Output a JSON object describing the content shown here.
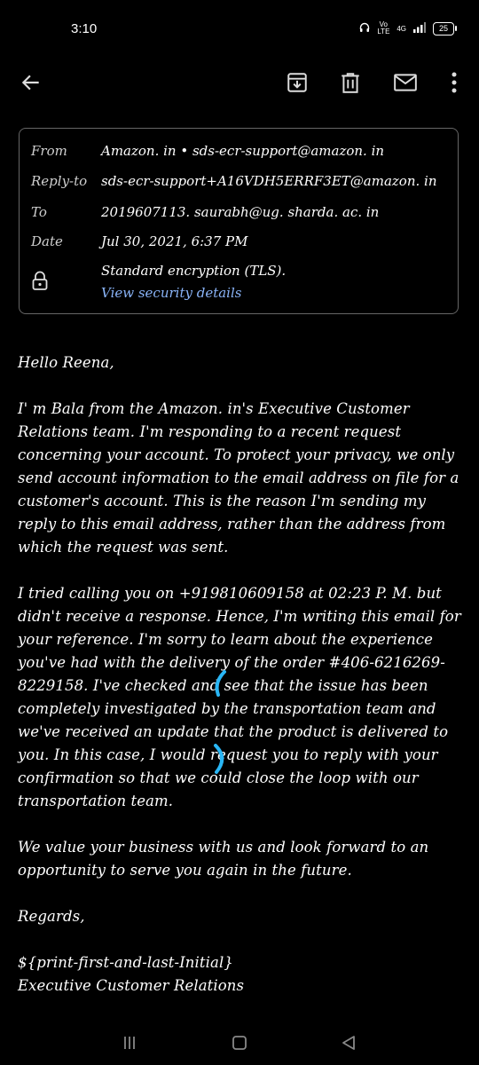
{
  "status": {
    "time": "3:10",
    "network": "4G",
    "volte": "Vo LTE",
    "battery": "25"
  },
  "header": {
    "from_label": "From",
    "from_value": "Amazon. in • sds-ecr-support@amazon. in",
    "reply_to_label": "Reply-to",
    "reply_to_value": "sds-ecr-support+A16VDH5ERRF3ET@amazon. in",
    "to_label": "To",
    "to_value": "2019607113. saurabh@ug. sharda. ac. in",
    "date_label": "Date",
    "date_value": "Jul 30, 2021, 6:37 PM",
    "encryption": "Standard encryption (TLS).",
    "security_link": "View security details"
  },
  "body": {
    "greeting": "Hello Reena,",
    "p1": "I' m Bala from the Amazon. in's Executive Customer Relations team. I'm responding to a recent request concerning your account. To protect your privacy, we only send account information to the email address on file for a customer's account. This is the reason I'm sending my reply to this email address, rather than the address from which the request was sent.",
    "p2": "I tried calling you on +919810609158 at 02:23 P. M. but didn't receive a response. Hence, I'm writing this email for your reference. I'm sorry to learn about the experience you've had with the delivery of the order #406-6216269-8229158. I've checked and see that the issue has been completely investigated by the transportation team and we've received an update that the product is delivered to you. In this case, I would request you to reply with your confirmation so that we could close the loop with our transportation team.",
    "p3": "We value your business with us and look forward to an opportunity to serve you again in the future.",
    "regards": "Regards,",
    "signature_name": "${print-first-and-last-Initial}",
    "signature_title": "Executive Customer Relations"
  },
  "colors": {
    "background": "#000000",
    "link": "#8ab4f8",
    "annotation": "#29b6f6",
    "label": "#cfcfcf"
  },
  "icons": [
    "back-arrow-icon",
    "archive-icon",
    "delete-icon",
    "mail-icon",
    "more-vert-icon",
    "lock-icon",
    "menu-icon",
    "home-icon",
    "back-nav-icon"
  ]
}
